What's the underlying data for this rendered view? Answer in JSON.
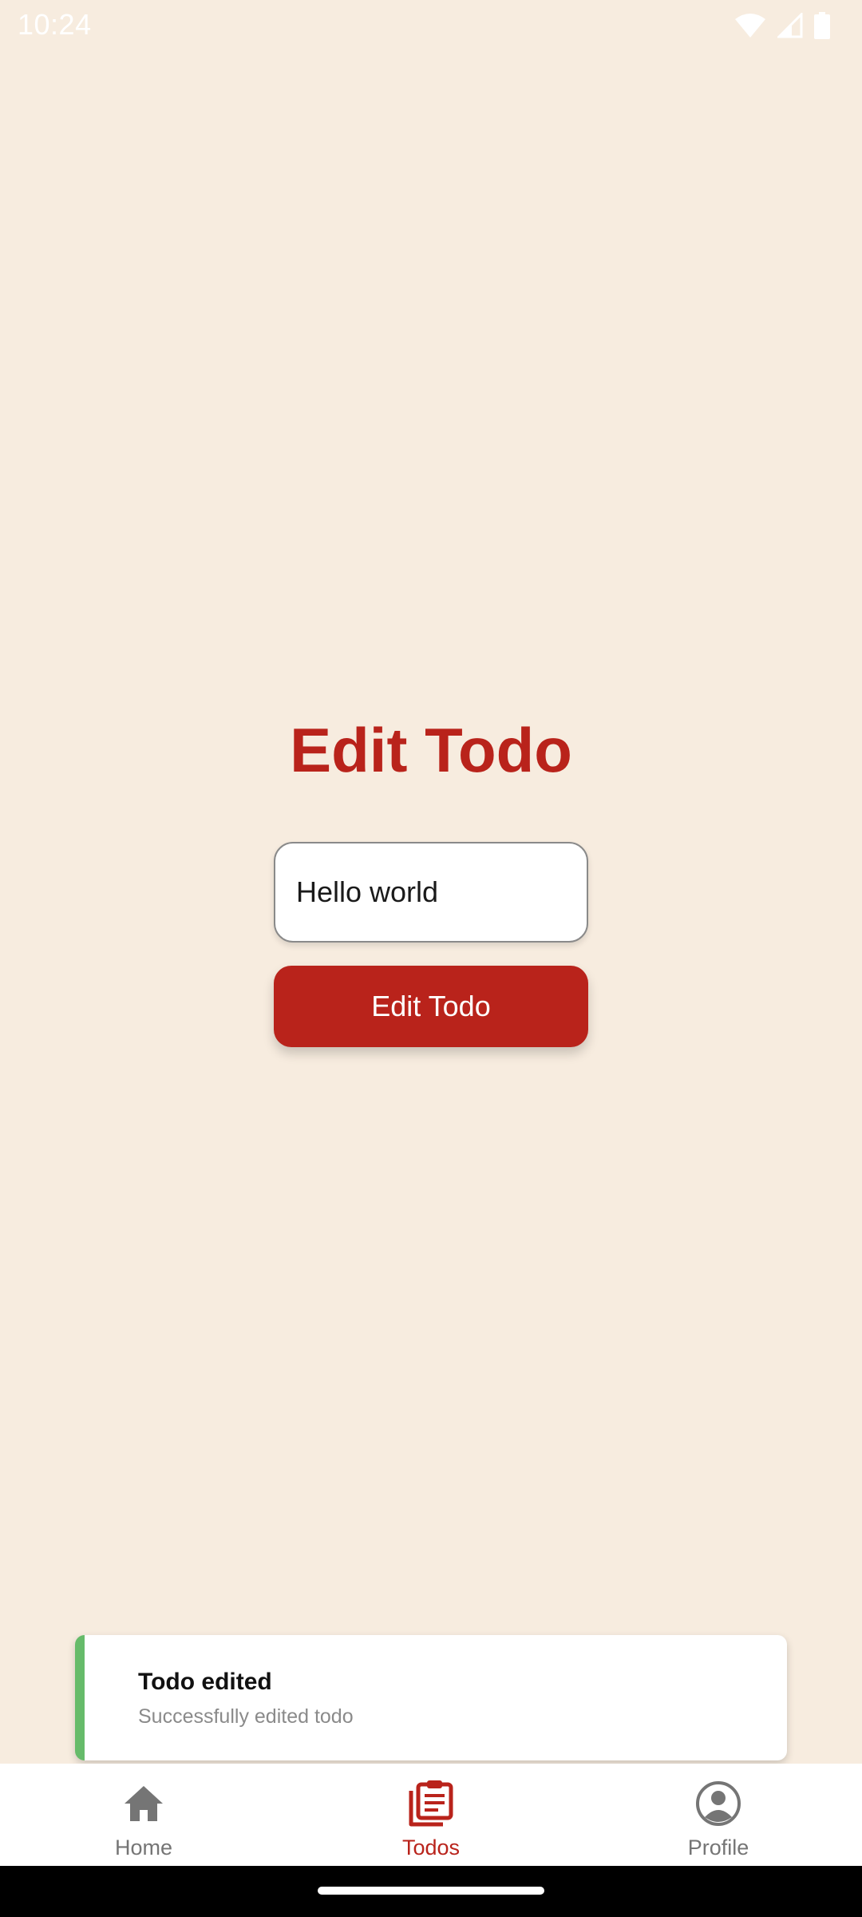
{
  "status_bar": {
    "time": "10:24"
  },
  "main": {
    "title": "Edit Todo",
    "input_value": "Hello world",
    "button_label": "Edit Todo"
  },
  "toast": {
    "title": "Todo edited",
    "message": "Successfully edited todo",
    "accent_color": "#66bb6a"
  },
  "bottom_nav": {
    "items": [
      {
        "label": "Home",
        "icon": "home-icon",
        "active": false
      },
      {
        "label": "Todos",
        "icon": "clipboard-icon",
        "active": true
      },
      {
        "label": "Profile",
        "icon": "user-circle-icon",
        "active": false
      }
    ]
  },
  "colors": {
    "background": "#f7ecdf",
    "primary": "#b9231b",
    "inactive": "#757575"
  }
}
